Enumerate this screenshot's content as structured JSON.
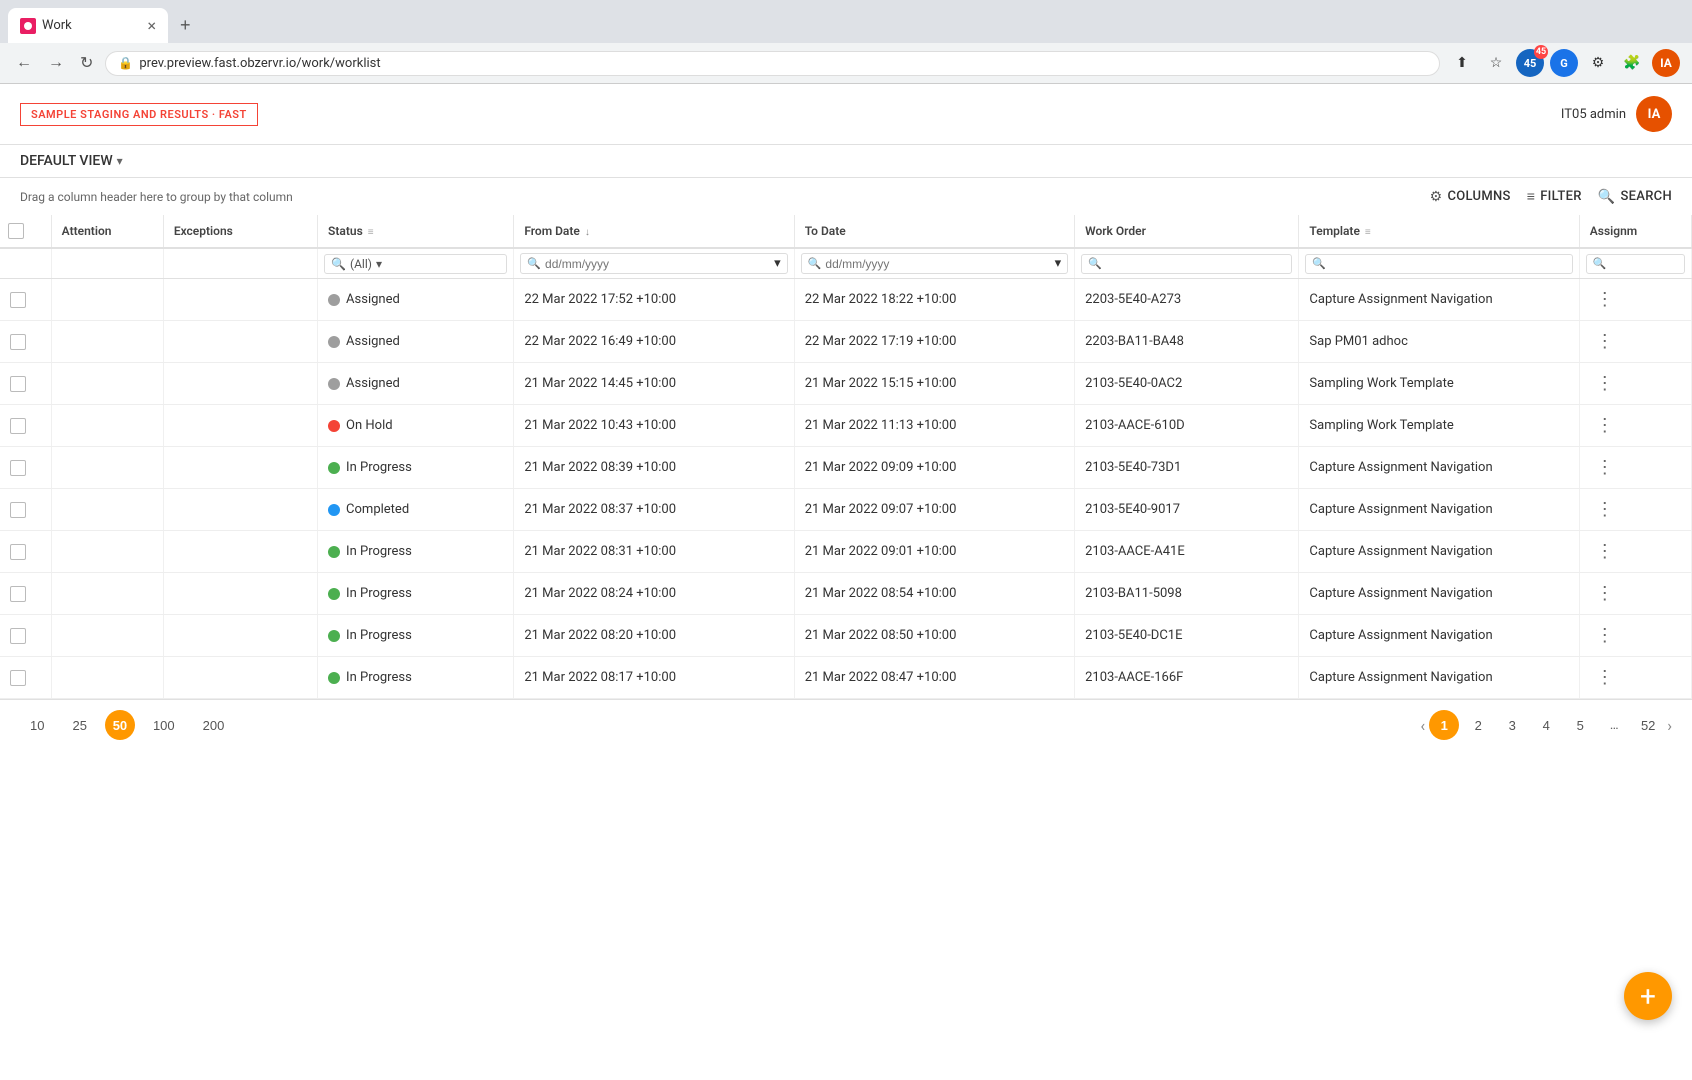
{
  "browser": {
    "tab_title": "Work",
    "url": "prev.preview.fast.obzervr.io/work/worklist",
    "tab_close": "×",
    "tab_new": "+",
    "nav_back": "←",
    "nav_forward": "→",
    "nav_reload": "↻",
    "ext1_count": "45",
    "user_initials": "IA"
  },
  "app_header": {
    "staging_badge": "SAMPLE STAGING AND RESULTS · FAST",
    "user_name": "IT05 admin",
    "user_initials": "IA"
  },
  "toolbar": {
    "view_label": "DEFAULT VIEW",
    "chevron": "▾"
  },
  "table_toolbar": {
    "drag_hint": "Drag a column header here to group by that column",
    "columns_label": "COLUMNS",
    "filter_label": "FILTER",
    "search_label": "SEARCH"
  },
  "columns": {
    "checkbox": "",
    "attention": "Attention",
    "exceptions": "Exceptions",
    "status": "Status",
    "from_date": "From Date",
    "to_date": "To Date",
    "work_order": "Work Order",
    "template": "Template",
    "assignment": "Assignm"
  },
  "filter_row": {
    "status_filter": "(All)",
    "from_date_placeholder": "dd/mm/yyyy",
    "to_date_placeholder": "dd/mm/yyyy"
  },
  "rows": [
    {
      "status": "Assigned",
      "status_color": "grey",
      "from_date": "22 Mar 2022 17:52 +10:00",
      "to_date": "22 Mar 2022 18:22 +10:00",
      "work_order": "2203-5E40-A273",
      "template": "Capture Assignment Navigation"
    },
    {
      "status": "Assigned",
      "status_color": "grey",
      "from_date": "22 Mar 2022 16:49 +10:00",
      "to_date": "22 Mar 2022 17:19 +10:00",
      "work_order": "2203-BA11-BA48",
      "template": "Sap PM01 adhoc"
    },
    {
      "status": "Assigned",
      "status_color": "grey",
      "from_date": "21 Mar 2022 14:45 +10:00",
      "to_date": "21 Mar 2022 15:15 +10:00",
      "work_order": "2103-5E40-0AC2",
      "template": "Sampling Work Template"
    },
    {
      "status": "On Hold",
      "status_color": "red",
      "from_date": "21 Mar 2022 10:43 +10:00",
      "to_date": "21 Mar 2022 11:13 +10:00",
      "work_order": "2103-AACE-610D",
      "template": "Sampling Work Template"
    },
    {
      "status": "In Progress",
      "status_color": "green",
      "from_date": "21 Mar 2022 08:39 +10:00",
      "to_date": "21 Mar 2022 09:09 +10:00",
      "work_order": "2103-5E40-73D1",
      "template": "Capture Assignment Navigation"
    },
    {
      "status": "Completed",
      "status_color": "blue",
      "from_date": "21 Mar 2022 08:37 +10:00",
      "to_date": "21 Mar 2022 09:07 +10:00",
      "work_order": "2103-5E40-9017",
      "template": "Capture Assignment Navigation"
    },
    {
      "status": "In Progress",
      "status_color": "green",
      "from_date": "21 Mar 2022 08:31 +10:00",
      "to_date": "21 Mar 2022 09:01 +10:00",
      "work_order": "2103-AACE-A41E",
      "template": "Capture Assignment Navigation"
    },
    {
      "status": "In Progress",
      "status_color": "green",
      "from_date": "21 Mar 2022 08:24 +10:00",
      "to_date": "21 Mar 2022 08:54 +10:00",
      "work_order": "2103-BA11-5098",
      "template": "Capture Assignment Navigation"
    },
    {
      "status": "In Progress",
      "status_color": "green",
      "from_date": "21 Mar 2022 08:20 +10:00",
      "to_date": "21 Mar 2022 08:50 +10:00",
      "work_order": "2103-5E40-DC1E",
      "template": "Capture Assignment Navigation"
    },
    {
      "status": "In Progress",
      "status_color": "green",
      "from_date": "21 Mar 2022 08:17 +10:00",
      "to_date": "21 Mar 2022 08:47 +10:00",
      "work_order": "2103-AACE-166F",
      "template": "Capture Assignment Navigation"
    }
  ],
  "pagination": {
    "sizes": [
      "10",
      "25",
      "50",
      "100",
      "200"
    ],
    "active_size": "50",
    "pages": [
      "1",
      "2",
      "3",
      "4",
      "5",
      "...",
      "52"
    ],
    "active_page": "1"
  },
  "fab": "+"
}
